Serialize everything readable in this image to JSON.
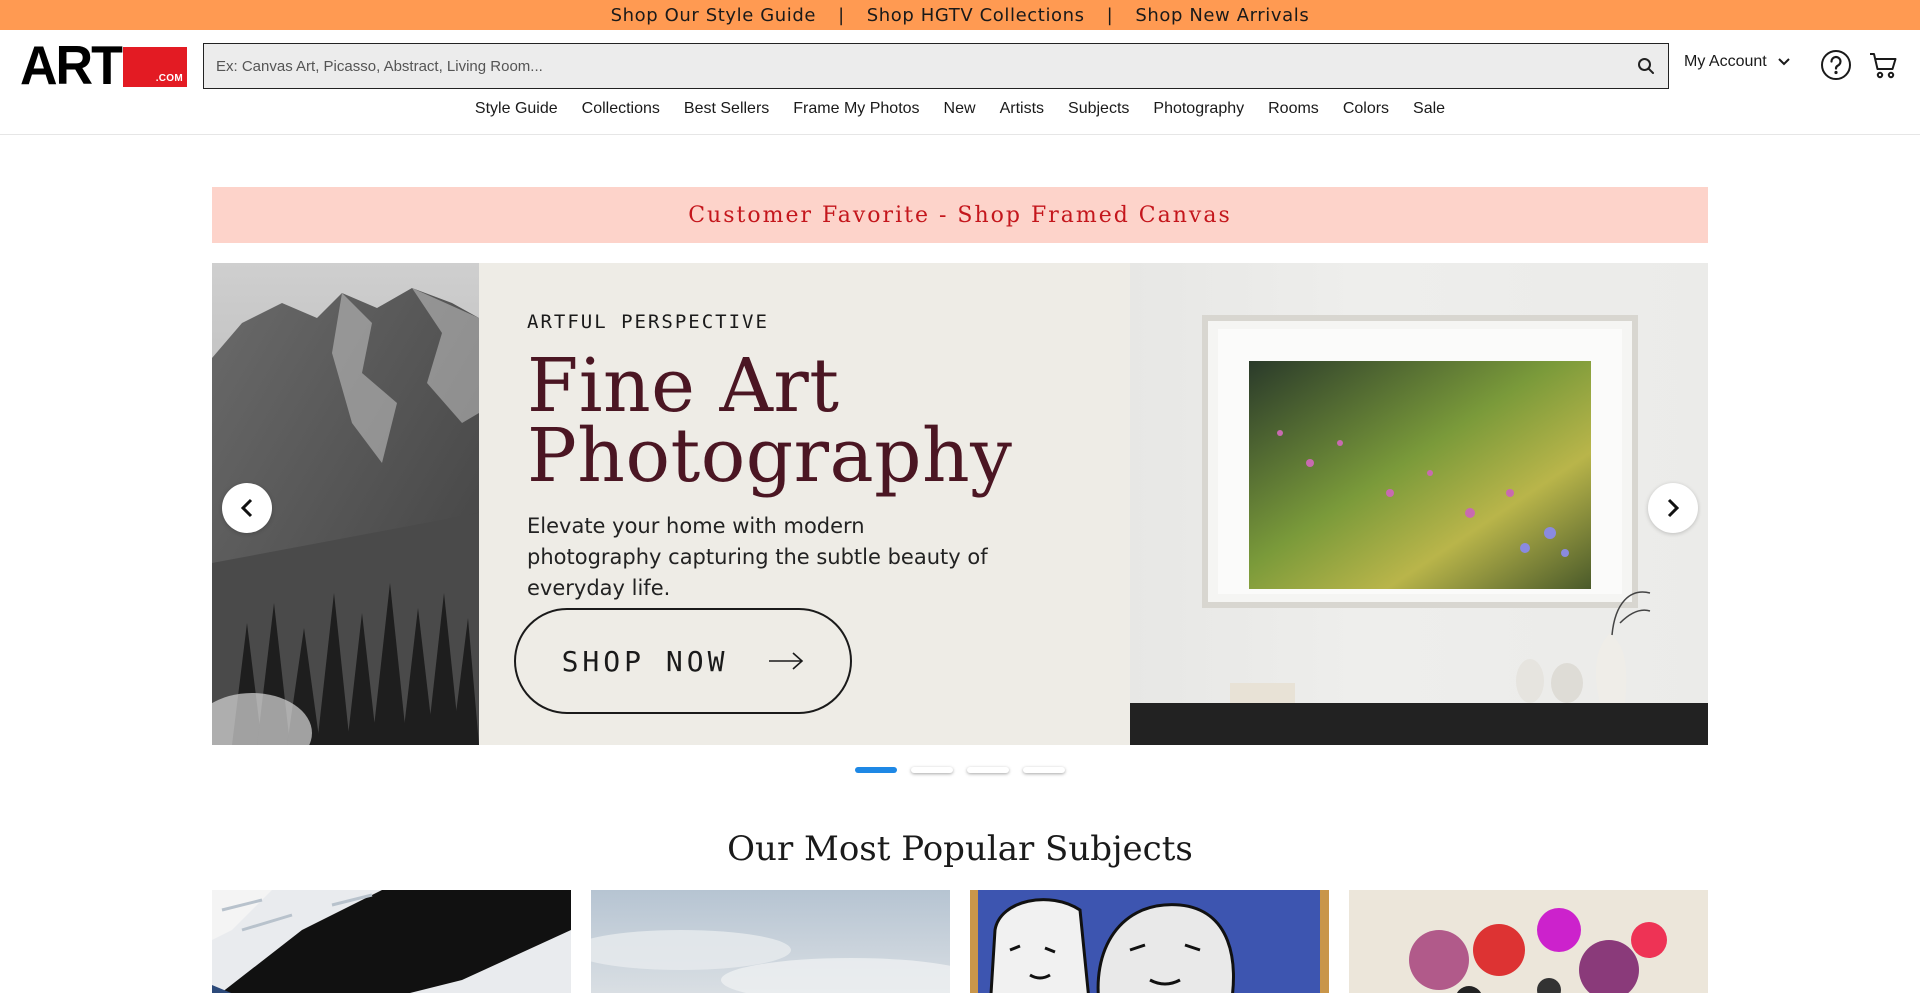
{
  "promo": {
    "links": [
      "Shop Our Style Guide",
      "Shop HGTV Collections",
      "Shop New Arrivals"
    ],
    "separator": "|"
  },
  "header": {
    "logo": {
      "main": "ART",
      "suffix": ".COM"
    },
    "search": {
      "placeholder": "Ex: Canvas Art, Picasso, Abstract, Living Room...",
      "value": ""
    },
    "account_label": "My Account",
    "nav": [
      "Style Guide",
      "Collections",
      "Best Sellers",
      "Frame My Photos",
      "New",
      "Artists",
      "Subjects",
      "Photography",
      "Rooms",
      "Colors",
      "Sale"
    ]
  },
  "sale_banner": "Customer Favorite - Shop Framed Canvas",
  "hero": {
    "eyebrow": "ARTFUL PERSPECTIVE",
    "headline_line1": "Fine Art",
    "headline_line2": "Photography",
    "subtext": "Elevate your home with modern photography capturing the subtle beauty of everyday life.",
    "cta": "SHOP NOW"
  },
  "carousel": {
    "slide_count": 4,
    "active_slide": 1
  },
  "popular_subjects": {
    "title": "Our Most Popular Subjects"
  },
  "colors": {
    "promo_bg": "#ff9a52",
    "banner_bg": "#fdd3ca",
    "banner_text": "#c4161c",
    "headline": "#4b1623",
    "logo_red": "#e31b23",
    "dot_active": "#1e88e5"
  },
  "icons": [
    "search-icon",
    "chevron-down-icon",
    "help-icon",
    "cart-icon",
    "chevron-left-icon",
    "chevron-right-icon",
    "arrow-right-icon"
  ]
}
